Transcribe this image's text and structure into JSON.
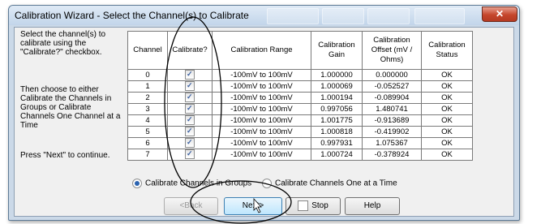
{
  "window": {
    "title": "Calibration Wizard - Select the Channel(s) to Calibrate",
    "close_icon": "close-icon"
  },
  "instructions": {
    "p1": "Select the channel(s) to calibrate using the \"Calibrate?\" checkbox.",
    "p2": "Then choose to either Calibrate the Channels in Groups or Calibrate Channels One Channel at a Time",
    "p3": "Press \"Next\" to continue."
  },
  "table": {
    "headers": [
      "Channel",
      "Calibrate?",
      "Calibration Range",
      "Calibration Gain",
      "Calibration Offset (mV / Ohms)",
      "Calibration Status"
    ],
    "rows": [
      {
        "channel": "0",
        "checked": true,
        "range": "-100mV to 100mV",
        "gain": "1.000000",
        "offset": "0.000000",
        "status": "OK"
      },
      {
        "channel": "1",
        "checked": true,
        "range": "-100mV to 100mV",
        "gain": "1.000069",
        "offset": "-0.052527",
        "status": "OK"
      },
      {
        "channel": "2",
        "checked": true,
        "range": "-100mV to 100mV",
        "gain": "1.000194",
        "offset": "-0.089904",
        "status": "OK"
      },
      {
        "channel": "3",
        "checked": true,
        "range": "-100mV to 100mV",
        "gain": "0.997056",
        "offset": "1.480741",
        "status": "OK"
      },
      {
        "channel": "4",
        "checked": true,
        "range": "-100mV to 100mV",
        "gain": "1.001775",
        "offset": "-0.913689",
        "status": "OK"
      },
      {
        "channel": "5",
        "checked": true,
        "range": "-100mV to 100mV",
        "gain": "1.000818",
        "offset": "-0.419902",
        "status": "OK"
      },
      {
        "channel": "6",
        "checked": true,
        "range": "-100mV to 100mV",
        "gain": "0.997931",
        "offset": "1.075367",
        "status": "OK"
      },
      {
        "channel": "7",
        "checked": true,
        "range": "-100mV to 100mV",
        "gain": "1.000724",
        "offset": "-0.378924",
        "status": "OK"
      }
    ]
  },
  "options": {
    "groups": {
      "label": "Calibrate Channels in Groups",
      "selected": true
    },
    "one_at_a_time": {
      "label": "Calibrate Channels One at a Time",
      "selected": false
    }
  },
  "buttons": {
    "back": "<Back",
    "next": "Next>",
    "stop": "Stop",
    "help": "Help"
  },
  "colors": {
    "title_bar": "#c2d5ea",
    "client_bg": "#f0f0f0",
    "close_button": "#c5462c",
    "radio_selected": "#2b63b0",
    "checkmark": "#3a5fa0"
  }
}
